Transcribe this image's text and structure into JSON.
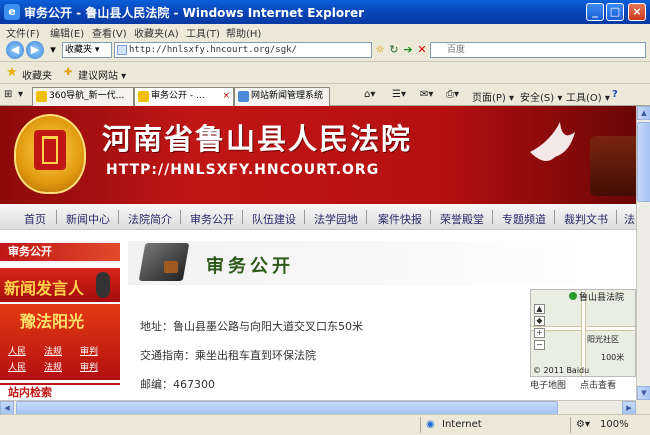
{
  "window": {
    "title": "审务公开 - 鲁山县人民法院 - Windows Internet Explorer",
    "minimize": "_",
    "maximize": "□",
    "close": "×"
  },
  "menu": [
    "文件(F)",
    "编辑(E)",
    "查看(V)",
    "收藏夹(A)",
    "工具(T)",
    "帮助(H)"
  ],
  "address": {
    "fav_dropdown": "收藏夹 ▾",
    "url": "http://hnlsxfy.hncourt.org/sgk/",
    "search_placeholder": "百度"
  },
  "favorites_bar": {
    "label": "收藏夹",
    "item1": "建议网站 ▾"
  },
  "tabs": [
    {
      "label": "360导航_新一代...",
      "active": false
    },
    {
      "label": "审务公开 - ...",
      "active": true
    },
    {
      "label": "网站新闻管理系统",
      "active": false
    }
  ],
  "command_bar": {
    "page": "页面(P) ▾",
    "safety": "安全(S) ▾",
    "tools": "工具(O) ▾",
    "help": "?"
  },
  "site": {
    "name": "河南省鲁山县人民法院",
    "url_text": "HTTP://HNLSXFY.HNCOURT.ORG"
  },
  "nav": [
    "首页",
    "新闻中心",
    "法院简介",
    "审务公开",
    "队伍建设",
    "法学园地",
    "案件快报",
    "荣誉殿堂",
    "专题频道",
    "裁判文书",
    "法"
  ],
  "left": {
    "section_title": "审务公开",
    "news_banner": "新闻发言人",
    "sun_banner": "豫法阳光",
    "sun_links": [
      "人民",
      "法规",
      "审判",
      "人民",
      "法规",
      "审判"
    ],
    "search_title": "站内检索"
  },
  "main": {
    "heading": "审务公开",
    "address_line": "地址：鲁山县墨公路与向阳大道交叉口东50米",
    "traffic_line": "交通指南：乘坐出租车直到环保法院",
    "postcode_line": "邮编：467300"
  },
  "map": {
    "place_label": "鲁山县法院",
    "road_label": "阳光社区",
    "scale_label": "100米",
    "copyright": "© 2011 Baidu",
    "footer_link": "电子地图",
    "footer_zoom": "点击查看"
  },
  "statusbar": {
    "zone": "Internet",
    "zoom": "100%"
  }
}
